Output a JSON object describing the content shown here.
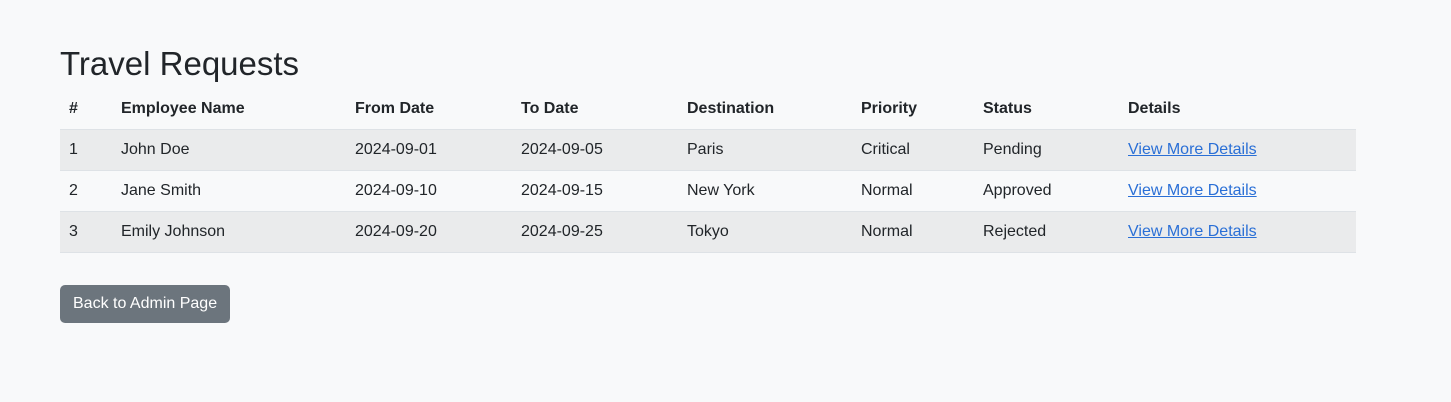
{
  "page": {
    "title": "Travel Requests"
  },
  "table": {
    "headers": [
      "#",
      "Employee Name",
      "From Date",
      "To Date",
      "Destination",
      "Priority",
      "Status",
      "Details"
    ],
    "rows": [
      {
        "num": "1",
        "name": "John Doe",
        "from": "2024-09-01",
        "to": "2024-09-05",
        "destination": "Paris",
        "priority": "Critical",
        "status": "Pending",
        "details": "View More Details"
      },
      {
        "num": "2",
        "name": "Jane Smith",
        "from": "2024-09-10",
        "to": "2024-09-15",
        "destination": "New York",
        "priority": "Normal",
        "status": "Approved",
        "details": "View More Details"
      },
      {
        "num": "3",
        "name": "Emily Johnson",
        "from": "2024-09-20",
        "to": "2024-09-25",
        "destination": "Tokyo",
        "priority": "Normal",
        "status": "Rejected",
        "details": "View More Details"
      }
    ]
  },
  "actions": {
    "back_label": "Back to Admin Page"
  },
  "colors": {
    "background": "#f8f9fa",
    "striped_row": "#eaebec",
    "link": "#2a6fd6",
    "secondary_button": "#6c757d"
  }
}
